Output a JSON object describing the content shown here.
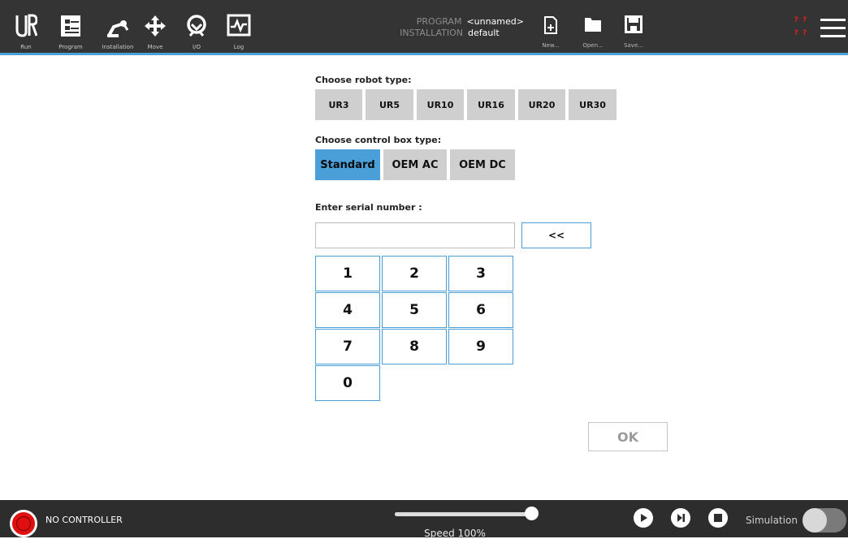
{
  "topbar": {
    "nav": [
      {
        "label": "Run",
        "icon": "ur-logo-icon"
      },
      {
        "label": "Program",
        "icon": "program-icon"
      },
      {
        "label": "Installation",
        "icon": "robot-arm-icon"
      },
      {
        "label": "Move",
        "icon": "move-arrows-icon"
      },
      {
        "label": "I/O",
        "icon": "io-icon"
      },
      {
        "label": "Log",
        "icon": "log-icon"
      }
    ],
    "program": {
      "key": "PROGRAM",
      "value": "<unnamed>"
    },
    "installation": {
      "key": "INSTALLATION",
      "value": "default"
    },
    "file": [
      {
        "label": "New...",
        "icon": "new-file-icon"
      },
      {
        "label": "Open...",
        "icon": "open-folder-icon"
      },
      {
        "label": "Save...",
        "icon": "save-icon"
      }
    ],
    "warning": {
      "line1": "? ?",
      "line2": "? ?",
      "color": "#e02020"
    },
    "accent_color": "#4a9fd8"
  },
  "robot_type": {
    "label": "Choose robot type:",
    "options": [
      "UR3",
      "UR5",
      "UR10",
      "UR16",
      "UR20",
      "UR30"
    ]
  },
  "control_box": {
    "label": "Choose control box type:",
    "options": [
      "Standard",
      "OEM AC",
      "OEM DC"
    ],
    "selected": "Standard"
  },
  "serial": {
    "label": "Enter serial number :",
    "value": "",
    "backspace_label": "<<"
  },
  "keypad": {
    "keys": [
      "1",
      "2",
      "3",
      "4",
      "5",
      "6",
      "7",
      "8",
      "9",
      "0"
    ]
  },
  "ok_label": "OK",
  "bottombar": {
    "status": "NO CONTROLLER",
    "speed_label": "Speed 100%",
    "speed_value": 100,
    "simulation_label": "Simulation",
    "simulation_on": false
  }
}
